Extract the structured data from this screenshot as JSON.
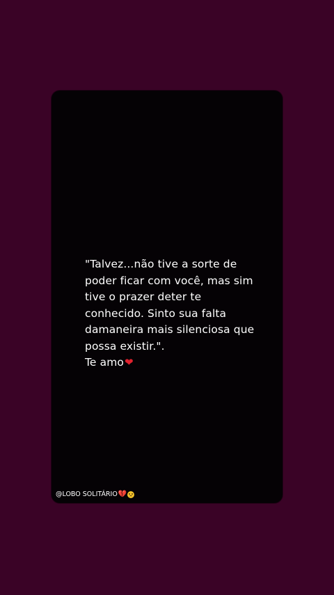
{
  "colors": {
    "background": "#3a0326",
    "card": "#050205",
    "text": "#ffffff",
    "heart": "#e0222e"
  },
  "post": {
    "quote": "\"Talvez...não tive a sorte de\npoder ficar com você, mas sim\ntive o prazer deter te\nconhecido. Sinto sua falta\ndamaneira mais silenciosa que\npossa existir.\".",
    "signoff": "Te amo",
    "signoff_icon": "red-heart-icon"
  },
  "watermark": {
    "handle": "@LOBO SOLITÁRIO",
    "icons": [
      "broken-heart-icon",
      "sad-face-icon"
    ]
  }
}
